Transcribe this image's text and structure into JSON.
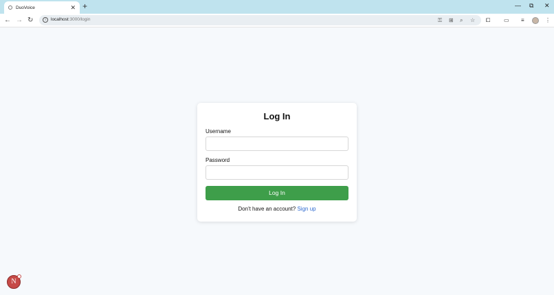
{
  "browser": {
    "tab_title": "DuoVoice",
    "tab_close": "✕",
    "new_tab": "+",
    "window_controls": {
      "minimize": "—",
      "restore": "⧉",
      "close": "✕"
    },
    "nav": {
      "back": "←",
      "forward": "→",
      "reload": "↻"
    },
    "url_host": "localhost",
    "url_path": ":3000/login"
  },
  "login": {
    "title": "Log In",
    "username_label": "Username",
    "username_value": "",
    "password_label": "Password",
    "password_value": "",
    "submit_label": "Log In",
    "signup_prompt": "Don't have an account?",
    "signup_link": "Sign up"
  },
  "badge": {
    "letter": "N"
  },
  "colors": {
    "primary_button": "#3e9e4a",
    "link": "#2f6ad0",
    "page_bg": "#f6f9fc",
    "tabstrip": "#bfe3ee"
  }
}
